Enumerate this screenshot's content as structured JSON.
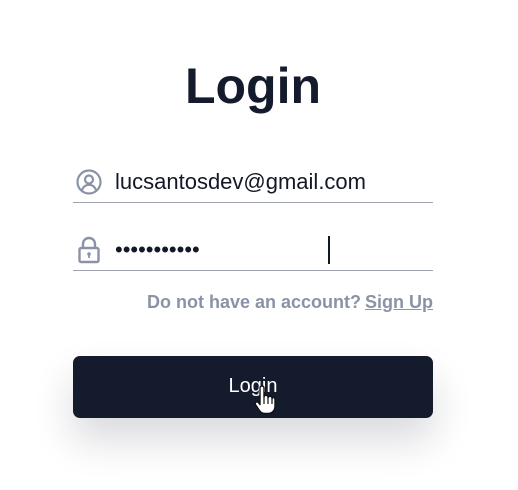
{
  "page": {
    "title": "Login"
  },
  "form": {
    "email": {
      "value": "lucsantosdev@gmail.com",
      "icon": "user-circle-icon"
    },
    "password": {
      "masked_value": "•••••••••••",
      "icon": "lock-icon"
    },
    "signup_prompt": "Do not have an account?",
    "signup_link": "Sign Up",
    "submit_label": "Login"
  },
  "colors": {
    "primary": "#141b2d",
    "muted": "#8a93a6",
    "border": "#9ca3af",
    "background": "#ffffff"
  }
}
